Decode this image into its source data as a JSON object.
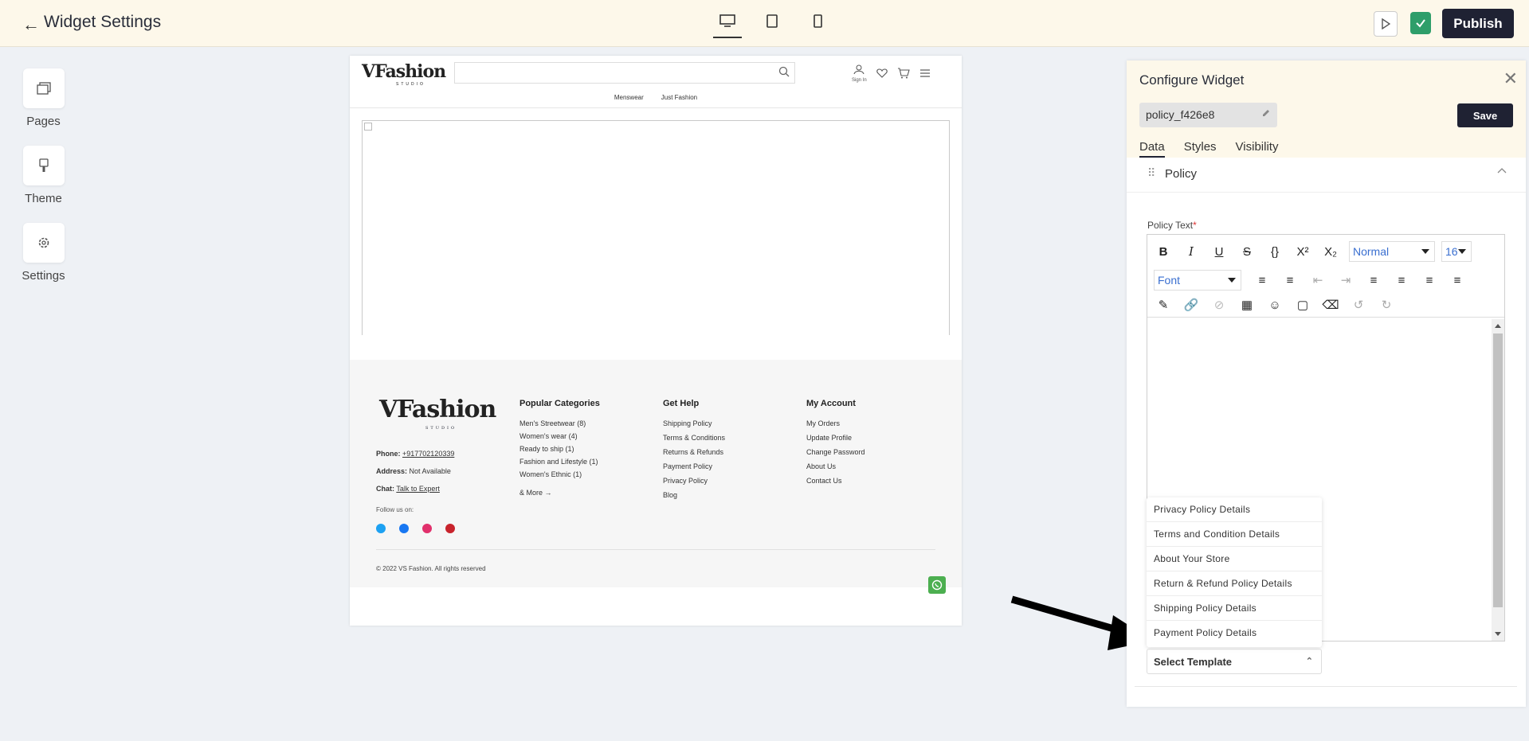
{
  "header": {
    "title": "Widget Settings",
    "publish_label": "Publish"
  },
  "sidebar": {
    "items": [
      {
        "label": "Pages",
        "icon": "pages-icon"
      },
      {
        "label": "Theme",
        "icon": "theme-brush-icon"
      },
      {
        "label": "Settings",
        "icon": "gear-icon"
      }
    ]
  },
  "preview": {
    "brand": "VFashion",
    "brand_sub": "STUDIO",
    "signin": "Sign In",
    "nav": [
      "Menswear",
      "Just Fashion"
    ],
    "footer": {
      "phone_label": "Phone:",
      "phone": "+917702120339",
      "address_label": "Address:",
      "address": "Not Available",
      "chat_label": "Chat:",
      "chat": "Talk to Expert",
      "follow": "Follow us on:",
      "columns": [
        {
          "title": "Popular Categories",
          "items": [
            "Men's Streetwear (8)",
            "Women's wear (4)",
            "Ready to ship (1)",
            "Fashion and Lifestyle (1)",
            "Women's Ethnic (1)"
          ],
          "more": "& More →"
        },
        {
          "title": "Get Help",
          "items": [
            "Shipping Policy",
            "Terms & Conditions",
            "Returns & Refunds",
            "Payment Policy",
            "Privacy Policy",
            "Blog"
          ]
        },
        {
          "title": "My Account",
          "items": [
            "My Orders",
            "Update Profile",
            "Change Password",
            "About Us",
            "Contact Us"
          ]
        }
      ],
      "copyright": "© 2022 VS Fashion. All rights reserved"
    }
  },
  "panel": {
    "title": "Configure Widget",
    "widget_name": "policy_f426e8",
    "save_label": "Save",
    "tabs": [
      "Data",
      "Styles",
      "Visibility"
    ],
    "section": "Policy",
    "field_label": "Policy Text",
    "required_mark": "*",
    "editor": {
      "format": "Normal",
      "size": "16",
      "font": "Font"
    },
    "template_options": [
      "Privacy Policy Details",
      "Terms and Condition Details",
      "About Your Store",
      "Return & Refund Policy Details",
      "Shipping Policy Details",
      "Payment Policy Details"
    ],
    "select_template": "Select Template"
  },
  "colors": {
    "topbar_bg": "#fdf8ea",
    "primary_dark": "#1f2233",
    "success_green": "#2e9e6a"
  }
}
